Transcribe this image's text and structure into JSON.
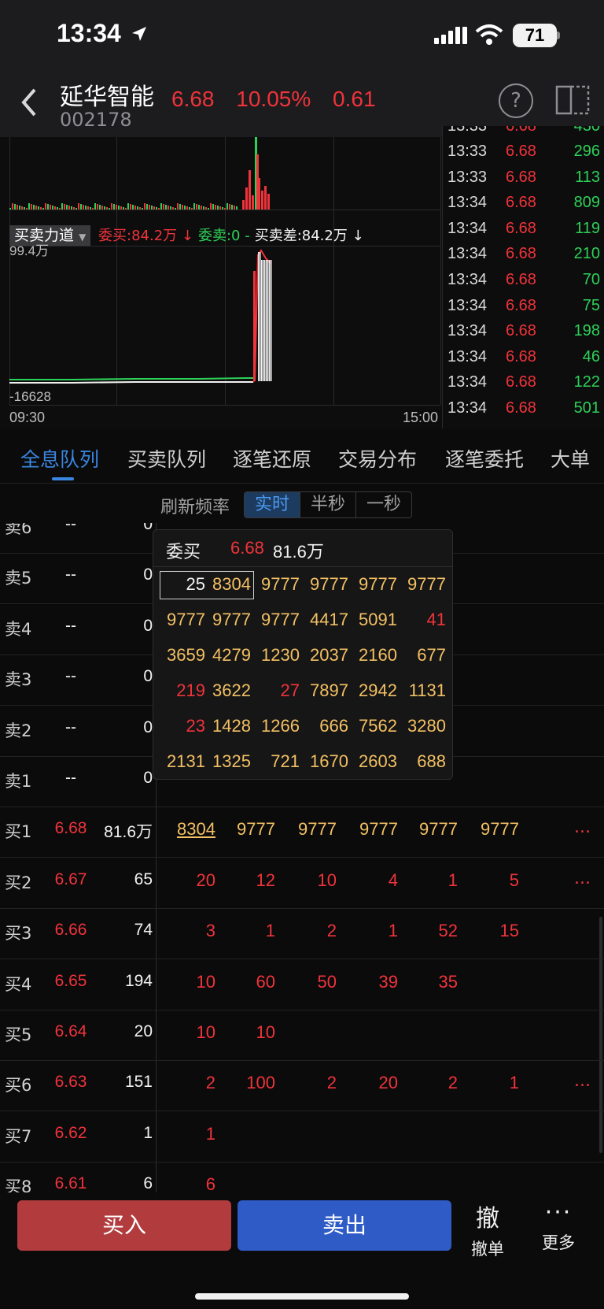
{
  "status_bar": {
    "time": "13:34",
    "battery": "71"
  },
  "header": {
    "stock_name": "延华智能",
    "stock_code": "002178",
    "price": "6.68",
    "change_pct": "10.05%",
    "change": "0.61"
  },
  "chart": {
    "power_selector": "买卖力道",
    "power_items": [
      {
        "text": "委买:84.2万 ↓",
        "color": "#f0333a"
      },
      {
        "text": "委卖:0 -",
        "color": "#2ed158"
      },
      {
        "text": "买卖差:84.2万 ↓",
        "color": "#f2f2f2"
      }
    ],
    "y_top": "99.4万",
    "y_bottom": "-16628",
    "x_start": "09:30",
    "x_end": "15:00"
  },
  "ticks": [
    {
      "time": "13:33",
      "price": "6.68",
      "vol": "296"
    },
    {
      "time": "13:33",
      "price": "6.68",
      "vol": "113"
    },
    {
      "time": "13:34",
      "price": "6.68",
      "vol": "809"
    },
    {
      "time": "13:34",
      "price": "6.68",
      "vol": "119"
    },
    {
      "time": "13:34",
      "price": "6.68",
      "vol": "210"
    },
    {
      "time": "13:34",
      "price": "6.68",
      "vol": "70"
    },
    {
      "time": "13:34",
      "price": "6.68",
      "vol": "75"
    },
    {
      "time": "13:34",
      "price": "6.68",
      "vol": "198"
    },
    {
      "time": "13:34",
      "price": "6.68",
      "vol": "46"
    },
    {
      "time": "13:34",
      "price": "6.68",
      "vol": "122"
    },
    {
      "time": "13:34",
      "price": "6.68",
      "vol": "501"
    }
  ],
  "tabs": [
    "全息队列",
    "买卖队列",
    "逐笔还原",
    "交易分布",
    "逐笔委托",
    "大单"
  ],
  "refresh": {
    "label": "刷新频率",
    "options": [
      "实时",
      "半秒",
      "一秒"
    ],
    "selected": "实时"
  },
  "sell_levels": [
    {
      "label": "卖6",
      "price": "--",
      "vol": "0"
    },
    {
      "label": "卖5",
      "price": "--",
      "vol": "0"
    },
    {
      "label": "卖4",
      "price": "--",
      "vol": "0"
    },
    {
      "label": "卖3",
      "price": "--",
      "vol": "0"
    },
    {
      "label": "卖2",
      "price": "--",
      "vol": "0"
    },
    {
      "label": "卖1",
      "price": "--",
      "vol": "0"
    }
  ],
  "buy_levels": [
    {
      "label": "买1",
      "price": "6.68",
      "vol": "81.6万",
      "orders": [
        "8304",
        "9777",
        "9777",
        "9777",
        "9777",
        "9777"
      ],
      "more": "..."
    },
    {
      "label": "买2",
      "price": "6.67",
      "vol": "65",
      "orders": [
        "20",
        "12",
        "10",
        "4",
        "1",
        "5"
      ],
      "more": "..."
    },
    {
      "label": "买3",
      "price": "6.66",
      "vol": "74",
      "orders": [
        "3",
        "1",
        "2",
        "1",
        "52",
        "15"
      ],
      "more": ""
    },
    {
      "label": "买4",
      "price": "6.65",
      "vol": "194",
      "orders": [
        "10",
        "60",
        "50",
        "39",
        "35"
      ],
      "more": ""
    },
    {
      "label": "买5",
      "price": "6.64",
      "vol": "20",
      "orders": [
        "10",
        "10"
      ],
      "more": ""
    },
    {
      "label": "买6",
      "price": "6.63",
      "vol": "151",
      "orders": [
        "2",
        "100",
        "2",
        "20",
        "2",
        "1"
      ],
      "more": "..."
    },
    {
      "label": "买7",
      "price": "6.62",
      "vol": "1",
      "orders": [
        "1"
      ],
      "more": ""
    },
    {
      "label": "买8",
      "price": "6.61",
      "vol": "6",
      "orders": [
        "6"
      ],
      "more": ""
    }
  ],
  "popup": {
    "label": "委买",
    "price": "6.68",
    "volume": "81.6万",
    "rows": [
      [
        "25",
        "8304",
        "9777",
        "9777",
        "9777",
        "9777"
      ],
      [
        "9777",
        "9777",
        "9777",
        "4417",
        "5091",
        "41"
      ],
      [
        "3659",
        "4279",
        "1230",
        "2037",
        "2160",
        "677"
      ],
      [
        "219",
        "3622",
        "27",
        "7897",
        "2942",
        "1131"
      ],
      [
        "23",
        "1428",
        "1266",
        "666",
        "7562",
        "3280"
      ],
      [
        "2131",
        "1325",
        "721",
        "1670",
        "2603",
        "688"
      ]
    ],
    "red_cells": [
      "0-0",
      "1-5",
      "3-0",
      "3-2",
      "4-0"
    ]
  },
  "bottom": {
    "buy": "买入",
    "sell": "卖出",
    "cancel_icon": "撤",
    "cancel": "撤单",
    "more": "更多"
  },
  "colors": {
    "up": "#f0333a",
    "down": "#2ed158",
    "order": "#f3c063",
    "accent": "#3a86e0"
  }
}
